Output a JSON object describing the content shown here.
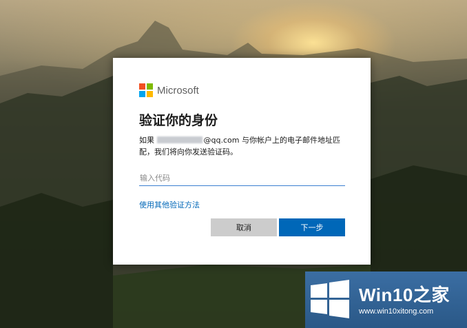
{
  "brand": {
    "name": "Microsoft",
    "logo_colors": [
      "#f25022",
      "#7fba00",
      "#00a4ef",
      "#ffb900"
    ]
  },
  "dialog": {
    "title": "验证你的身份",
    "description_prefix": "如果",
    "description_email_suffix": "@qq.com",
    "description_rest": "与你帐户上的电子邮件地址匹配，我们将向你发送验证码。",
    "code_placeholder": "输入代码",
    "alt_method_link": "使用其他验证方法",
    "cancel_label": "取消",
    "next_label": "下一步",
    "accent_color": "#0067b8"
  },
  "watermark": {
    "brand": "Win10之家",
    "url": "www.win10xitong.com"
  }
}
